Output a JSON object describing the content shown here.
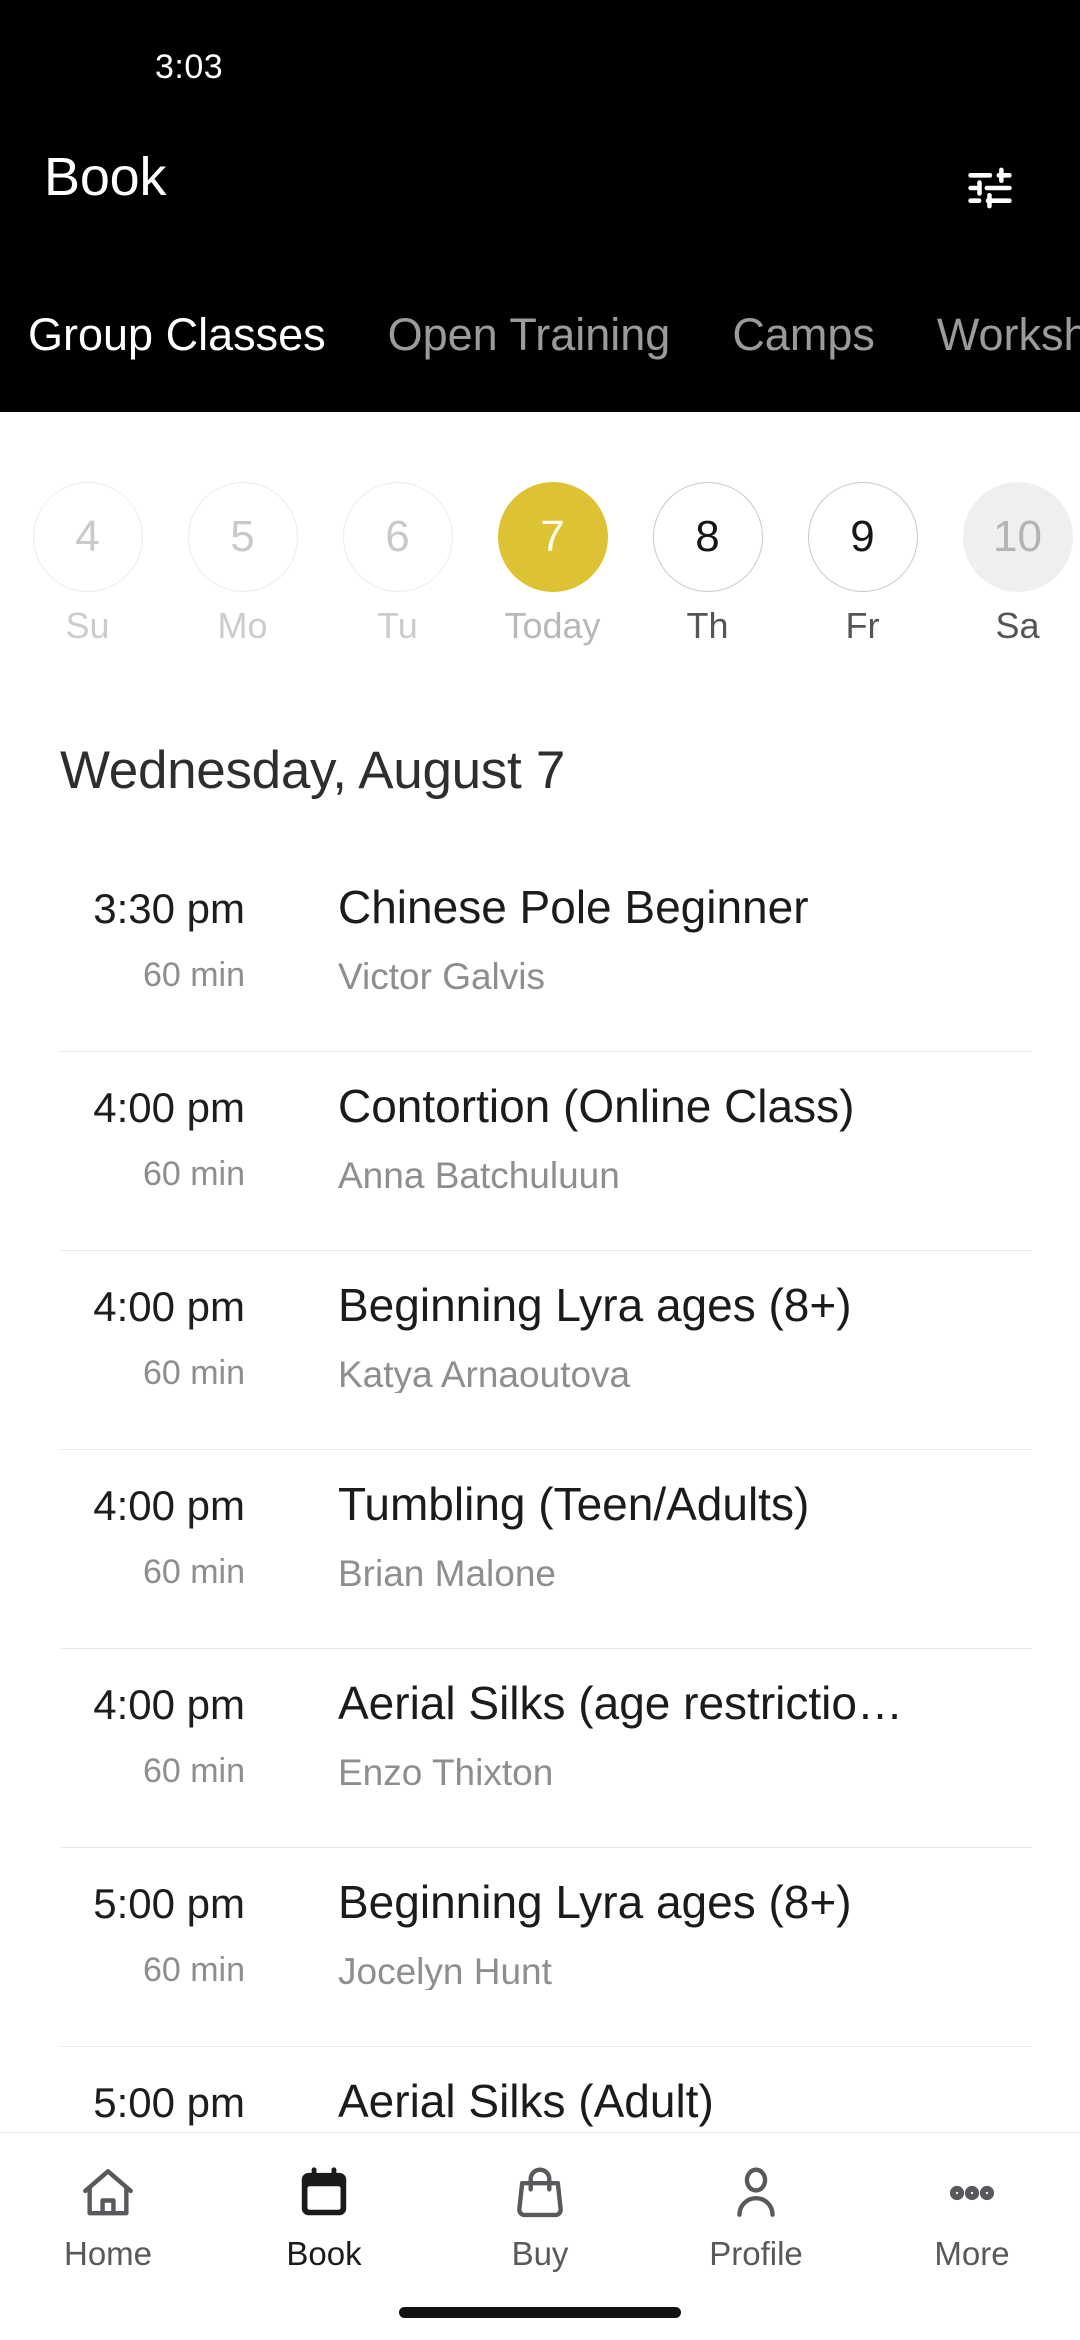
{
  "status_bar": {
    "time": "3:03"
  },
  "app_bar": {
    "title": "Book",
    "filter_icon": "tune-icon"
  },
  "tabs": [
    {
      "label": "Group Classes",
      "active": true
    },
    {
      "label": "Open Training",
      "active": false
    },
    {
      "label": "Camps",
      "active": false
    },
    {
      "label": "Workshops",
      "active": false
    }
  ],
  "date_strip": [
    {
      "day": "4",
      "label": "Su",
      "state": "past"
    },
    {
      "day": "5",
      "label": "Mo",
      "state": "past"
    },
    {
      "day": "6",
      "label": "Tu",
      "state": "past"
    },
    {
      "day": "7",
      "label": "Today",
      "state": "today"
    },
    {
      "day": "8",
      "label": "Th",
      "state": "future"
    },
    {
      "day": "9",
      "label": "Fr",
      "state": "future"
    },
    {
      "day": "10",
      "label": "Sa",
      "state": "muted"
    }
  ],
  "day_heading": "Wednesday, August 7",
  "classes": [
    {
      "time": "3:30 pm",
      "duration": "60 min",
      "title": "Chinese Pole Beginner",
      "staff": "Victor Galvis"
    },
    {
      "time": "4:00 pm",
      "duration": "60 min",
      "title": "Contortion (Online Class)",
      "staff": "Anna Batchuluun"
    },
    {
      "time": "4:00 pm",
      "duration": "60 min",
      "title": "Beginning Lyra ages (8+)",
      "staff": "Katya Arnaoutova"
    },
    {
      "time": "4:00 pm",
      "duration": "60 min",
      "title": "Tumbling (Teen/Adults)",
      "staff": "Brian Malone"
    },
    {
      "time": "4:00 pm",
      "duration": "60 min",
      "title": "Aerial Silks (age restrictio…",
      "staff": "Enzo Thixton"
    },
    {
      "time": "5:00 pm",
      "duration": "60 min",
      "title": "Beginning Lyra ages (8+)",
      "staff": "Jocelyn Hunt"
    },
    {
      "time": "5:00 pm",
      "duration": "",
      "title": "Aerial Silks (Adult)",
      "staff": ""
    }
  ],
  "bottom_nav": [
    {
      "label": "Home",
      "icon": "home-icon",
      "active": false
    },
    {
      "label": "Book",
      "icon": "calendar-icon",
      "active": true
    },
    {
      "label": "Buy",
      "icon": "bag-icon",
      "active": false
    },
    {
      "label": "Profile",
      "icon": "person-icon",
      "active": false
    },
    {
      "label": "More",
      "icon": "ellipsis-icon",
      "active": false
    }
  ],
  "colors": {
    "accent_yellow": "#ddc333",
    "header_black": "#000000",
    "text_primary": "#1b1b1b",
    "text_secondary": "#8e8e8e",
    "divider": "#e8e8e8"
  }
}
